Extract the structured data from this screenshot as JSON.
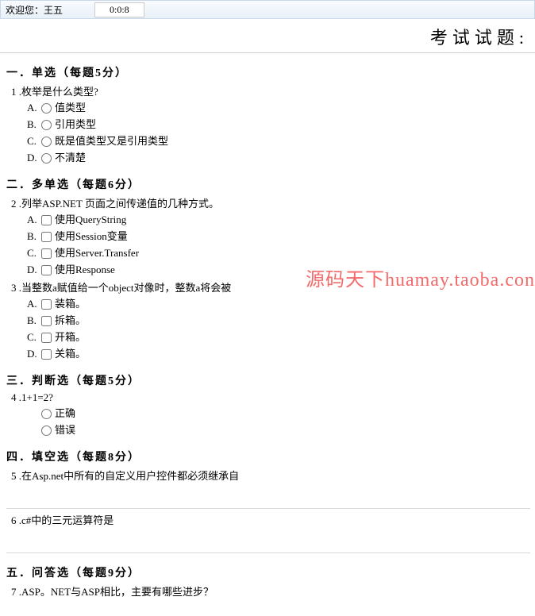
{
  "topbar": {
    "welcome": "欢迎您：王五",
    "timer": "0:0:8"
  },
  "page_title": "考试试题:",
  "watermark": "源码天下huamay.taoba.con",
  "sections": [
    {
      "heading": "一．单选（每题5分）",
      "questions": [
        {
          "num": "1",
          "text": ".枚举是什么类型?",
          "input_type": "radio",
          "options": [
            {
              "letter": "A.",
              "label": "值类型"
            },
            {
              "letter": "B.",
              "label": "引用类型"
            },
            {
              "letter": "C.",
              "label": "既是值类型又是引用类型"
            },
            {
              "letter": "D.",
              "label": "不清楚"
            }
          ]
        }
      ]
    },
    {
      "heading": "二．多单选（每题6分）",
      "questions": [
        {
          "num": "2",
          "text": ".列举ASP.NET 页面之间传递值的几种方式。",
          "input_type": "checkbox",
          "options": [
            {
              "letter": "A.",
              "label": "使用QueryString"
            },
            {
              "letter": "B.",
              "label": "使用Session变量"
            },
            {
              "letter": "C.",
              "label": "使用Server.Transfer"
            },
            {
              "letter": "D.",
              "label": "使用Response"
            }
          ]
        },
        {
          "num": "3",
          "text": ".当整数a赋值给一个object对像时，整数a将会被",
          "input_type": "checkbox",
          "options": [
            {
              "letter": "A.",
              "label": "装箱。"
            },
            {
              "letter": "B.",
              "label": "拆箱。"
            },
            {
              "letter": "C.",
              "label": "开箱。"
            },
            {
              "letter": "D.",
              "label": "关箱。"
            }
          ]
        }
      ]
    },
    {
      "heading": "三．判断选（每题5分）",
      "questions": [
        {
          "num": "4",
          "text": ".1+1=2?",
          "input_type": "radio",
          "options": [
            {
              "letter": "",
              "label": "正确"
            },
            {
              "letter": "",
              "label": "错误"
            }
          ]
        }
      ]
    },
    {
      "heading": "四．填空选（每题8分）",
      "questions": [
        {
          "num": "5",
          "text": ".在Asp.net中所有的自定义用户控件都必须继承自",
          "input_type": "none",
          "options": []
        },
        {
          "num": "6",
          "text": ".c#中的三元运算符是",
          "input_type": "none",
          "options": [],
          "hr_before": true
        }
      ]
    },
    {
      "heading": "五．问答选（每题9分）",
      "hr_before": true,
      "questions": [
        {
          "num": "7",
          "text": ".ASP。NET与ASP相比，主要有哪些进步？",
          "input_type": "none",
          "options": []
        }
      ]
    }
  ]
}
